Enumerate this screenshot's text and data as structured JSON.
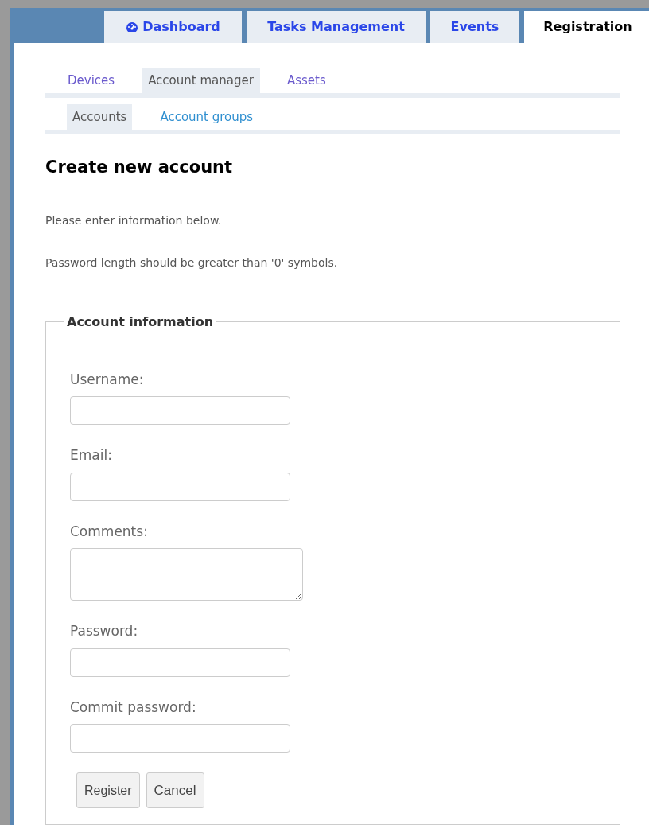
{
  "tabs": [
    {
      "label": "Dashboard",
      "icon": true,
      "selected": false
    },
    {
      "label": "Tasks Management",
      "icon": false,
      "selected": false
    },
    {
      "label": "Events",
      "icon": false,
      "selected": false
    },
    {
      "label": "Registration",
      "icon": false,
      "selected": true
    }
  ],
  "subnav": [
    {
      "label": "Devices",
      "selected": false
    },
    {
      "label": "Account manager",
      "selected": true
    },
    {
      "label": "Assets",
      "selected": false
    }
  ],
  "subnav2": [
    {
      "label": "Accounts",
      "selected": true
    },
    {
      "label": "Account groups",
      "selected": false
    }
  ],
  "heading": "Create new account",
  "notes": [
    "Please enter information below.",
    "Password length should be greater than '0' symbols."
  ],
  "fieldset": {
    "legend": "Account information",
    "fields": [
      {
        "label": "Username:",
        "kind": "text"
      },
      {
        "label": "Email:",
        "kind": "text"
      },
      {
        "label": "Comments:",
        "kind": "textarea"
      },
      {
        "label": "Password:",
        "kind": "text"
      },
      {
        "label": "Commit password:",
        "kind": "text"
      }
    ],
    "buttons": [
      "Register",
      "Cancel"
    ]
  }
}
